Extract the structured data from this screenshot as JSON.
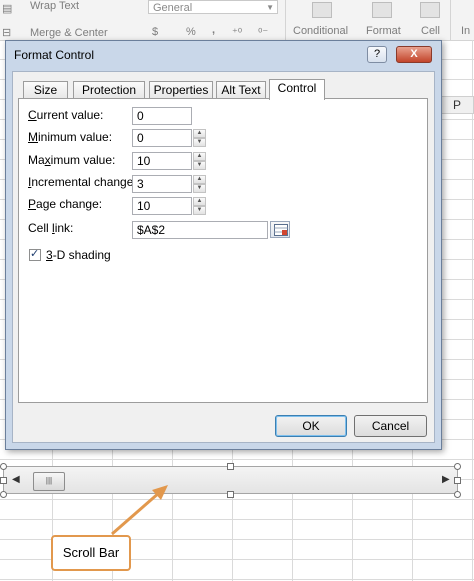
{
  "ribbon": {
    "wrap_text": "Wrap Text",
    "merge_center": "Merge & Center",
    "number_format": "General",
    "percent": "%",
    "comma": ",",
    "conditional": "Conditional",
    "format": "Format",
    "cell": "Cell",
    "ins": "In"
  },
  "sheet": {
    "column_p": "P"
  },
  "dialog": {
    "title": "Format Control",
    "help": "?",
    "close": "X",
    "tabs": [
      "Size",
      "Protection",
      "Properties",
      "Alt Text",
      "Control"
    ],
    "active_tab": "Control",
    "fields": {
      "current_value": {
        "label_u": "C",
        "label_rest": "urrent value:",
        "value": "0"
      },
      "minimum_value": {
        "label_u": "M",
        "label_rest": "inimum value:",
        "value": "0"
      },
      "maximum_value": {
        "label_pre": "Ma",
        "label_u": "x",
        "label_rest": "imum value:",
        "value": "10"
      },
      "incremental_change": {
        "label_u": "I",
        "label_rest": "ncremental change:",
        "value": "3"
      },
      "page_change": {
        "label_u": "P",
        "label_rest": "age change:",
        "value": "10"
      },
      "cell_link": {
        "label_pre": "Cell ",
        "label_u": "l",
        "label_rest": "ink:",
        "value": "$A$2"
      }
    },
    "shading": {
      "label_u": "3",
      "label_rest": "-D shading",
      "checked": true,
      "mark": "✓"
    },
    "ok": "OK",
    "cancel": "Cancel"
  },
  "scrollbar": {
    "thumb_grip": "|||",
    "left_arrow": "◀",
    "right_arrow": "▶"
  },
  "callout": {
    "text": "Scroll Bar",
    "color": "#e2984d"
  }
}
